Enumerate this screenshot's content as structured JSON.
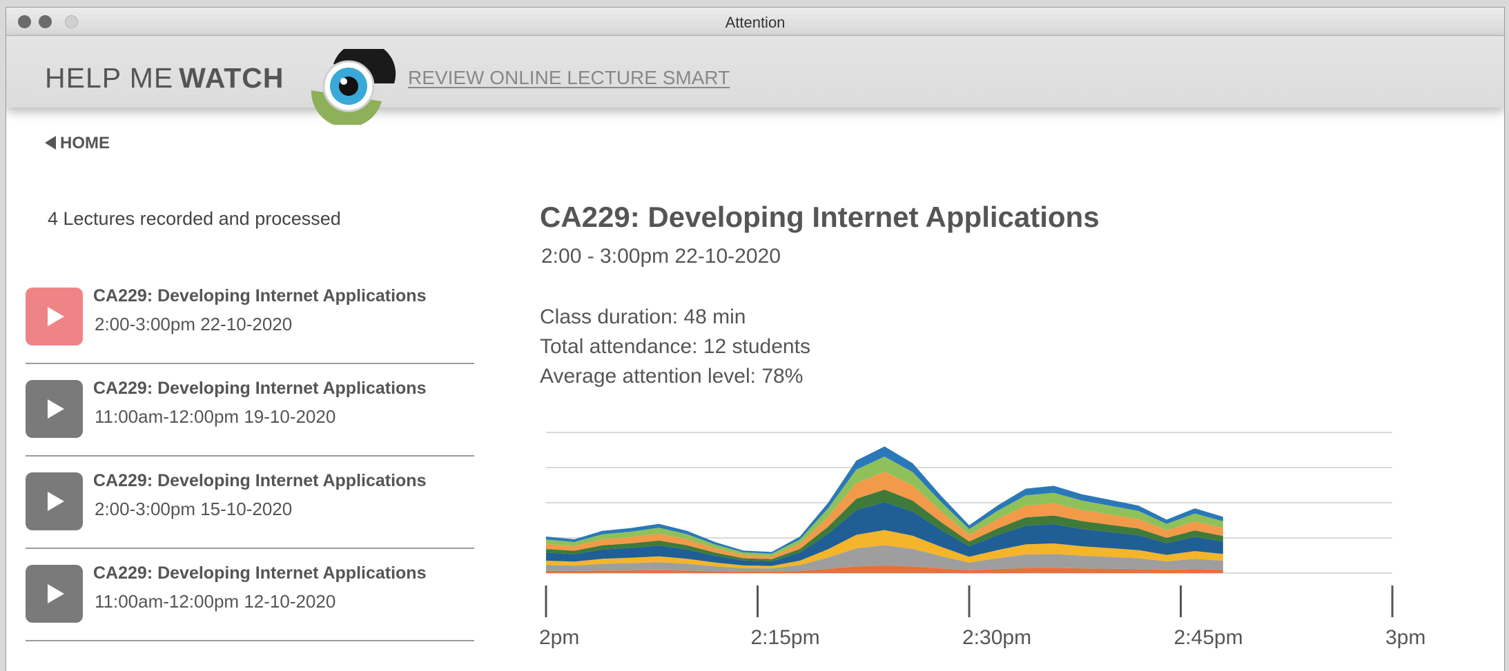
{
  "window": {
    "title": "Attention"
  },
  "header": {
    "brand_light": "HELP ME",
    "brand_bold": "WATCH",
    "tagline": "REVIEW ONLINE LECTURE SMART",
    "logo_icon": "eye-icon"
  },
  "nav": {
    "home_label": "HOME"
  },
  "sidebar": {
    "count_text": "4 Lectures recorded and processed",
    "lectures": [
      {
        "title": "CA229: Developing Internet Applications",
        "time": "2:00-3:00pm 22-10-2020",
        "active": true
      },
      {
        "title": "CA229: Developing Internet Applications",
        "time": "11:00am-12:00pm 19-10-2020",
        "active": false
      },
      {
        "title": "CA229: Developing Internet Applications",
        "time": "2:00-3:00pm 15-10-2020",
        "active": false
      },
      {
        "title": "CA229: Developing Internet Applications",
        "time": "11:00am-12:00pm 12-10-2020",
        "active": false
      }
    ]
  },
  "details": {
    "title": "CA229: Developing Internet Applications",
    "time": "2:00 - 3:00pm 22-10-2020",
    "duration": "Class duration: 48 min",
    "attendance": "Total attendance: 12 students",
    "attention": "Average attention level: 78%"
  },
  "colors": {
    "active_play": "#ef8486",
    "inactive_play": "#7a7a7a",
    "series": [
      "#e8703a",
      "#9e9e9e",
      "#f4b52a",
      "#1f5f95",
      "#3f7a3a",
      "#f29a4a",
      "#8fc15a",
      "#2b78b8"
    ]
  },
  "chart_data": {
    "type": "area",
    "stacked": true,
    "x_ticks": [
      "2pm",
      "2:15pm",
      "2:30pm",
      "2:45pm",
      "3pm"
    ],
    "x_range_minutes": [
      0,
      60
    ],
    "data_end_minutes": 48,
    "grid": true,
    "x_minutes": [
      0,
      2,
      4,
      6,
      8,
      10,
      12,
      14,
      16,
      18,
      20,
      22,
      24,
      26,
      28,
      30,
      32,
      34,
      36,
      38,
      40,
      42,
      44,
      46,
      48
    ],
    "totals": [
      26,
      24,
      30,
      32,
      35,
      30,
      22,
      16,
      15,
      26,
      50,
      80,
      90,
      78,
      55,
      34,
      48,
      60,
      62,
      56,
      52,
      48,
      38,
      46,
      40
    ],
    "series_share": [
      0.06,
      0.16,
      0.12,
      0.22,
      0.1,
      0.14,
      0.12,
      0.08
    ]
  }
}
